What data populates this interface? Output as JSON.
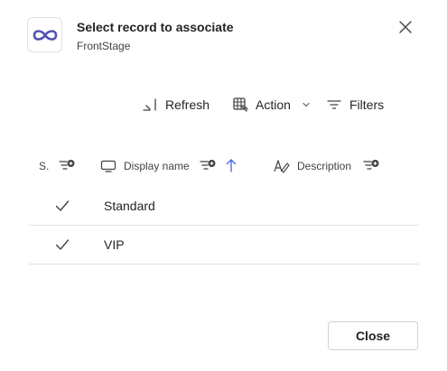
{
  "dialog": {
    "title": "Select record to associate",
    "subtitle": "FrontStage",
    "app_icon": "infinity-logo-icon",
    "accent_color": "#4f52b2"
  },
  "toolbar": {
    "refresh_label": "Refresh",
    "action_label": "Action",
    "filters_label": "Filters"
  },
  "table": {
    "columns": [
      {
        "label": "S.",
        "icon": "status-column"
      },
      {
        "label": "Display name",
        "icon": "display-icon",
        "sort": "ascending"
      },
      {
        "label": "Description",
        "icon": "text-edit-icon"
      }
    ],
    "rows": [
      {
        "display_name": "Standard",
        "selected": true
      },
      {
        "display_name": "VIP",
        "selected": true
      }
    ]
  },
  "footer": {
    "close_label": "Close"
  }
}
